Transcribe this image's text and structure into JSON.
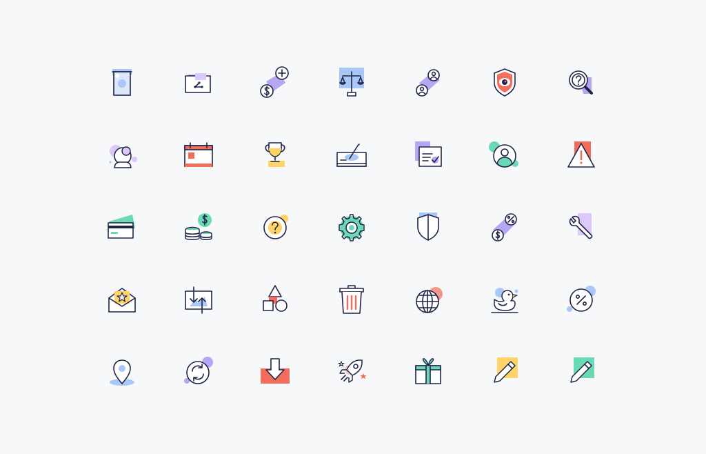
{
  "palette": {
    "ink": "#1f2346",
    "blue": "#a9c8f5",
    "purple": "#b7a6f2",
    "lilac": "#dcc8fb",
    "coral": "#f26d5b",
    "yellow": "#ffd366",
    "mint": "#6bd9b5",
    "background": "#f7f8fa"
  },
  "icons": [
    {
      "name": "atm-cash-icon"
    },
    {
      "name": "shared-folder-icon"
    },
    {
      "name": "add-money-icon"
    },
    {
      "name": "balance-scale-icon"
    },
    {
      "name": "users-exchange-icon"
    },
    {
      "name": "security-shield-eye-icon"
    },
    {
      "name": "search-help-icon"
    },
    {
      "name": "crystal-ball-icon"
    },
    {
      "name": "calendar-icon"
    },
    {
      "name": "trophy-icon"
    },
    {
      "name": "cash-signature-icon"
    },
    {
      "name": "approved-document-icon"
    },
    {
      "name": "user-profile-icon"
    },
    {
      "name": "warning-icon"
    },
    {
      "name": "credit-cards-icon"
    },
    {
      "name": "coins-dollar-icon"
    },
    {
      "name": "help-circle-icon"
    },
    {
      "name": "gear-icon"
    },
    {
      "name": "shield-icon"
    },
    {
      "name": "currency-percent-icon"
    },
    {
      "name": "wrench-icon"
    },
    {
      "name": "mail-star-icon"
    },
    {
      "name": "transfer-arrows-icon"
    },
    {
      "name": "shapes-icon"
    },
    {
      "name": "trash-icon"
    },
    {
      "name": "globe-icon"
    },
    {
      "name": "rubber-duck-icon"
    },
    {
      "name": "percent-circle-icon"
    },
    {
      "name": "location-pin-icon"
    },
    {
      "name": "refresh-icon"
    },
    {
      "name": "download-icon"
    },
    {
      "name": "rocket-icon"
    },
    {
      "name": "gift-icon"
    },
    {
      "name": "pencil-yellow-icon"
    },
    {
      "name": "pencil-mint-icon"
    }
  ]
}
